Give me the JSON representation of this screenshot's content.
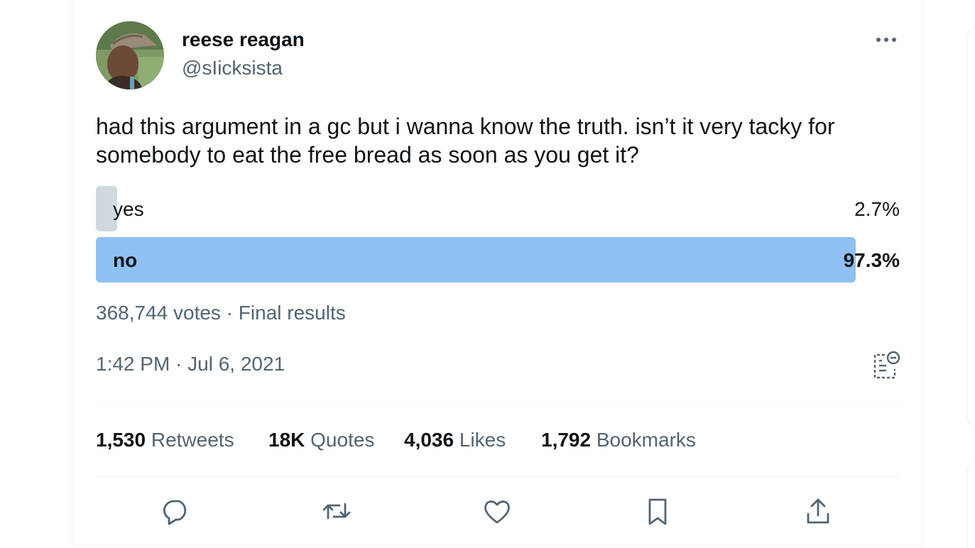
{
  "tweet": {
    "author": {
      "display_name": "reese reagan",
      "handle": "@sIicksista"
    },
    "text": "had this argument in a gc but i wanna know the truth. isn’t it very tacky for somebody to eat the free bread as soon as you get it?",
    "poll": {
      "options": [
        {
          "label": "yes",
          "percent_text": "2.7%",
          "percent": 2.7,
          "winner": false
        },
        {
          "label": "no",
          "percent_text": "97.3%",
          "percent": 97.3,
          "winner": true
        }
      ],
      "meta": "368,744 votes · Final results"
    },
    "timestamp": "1:42 PM · Jul 6, 2021",
    "stats": {
      "retweets": {
        "count": "1,530",
        "label": "Retweets"
      },
      "quotes": {
        "count": "18K",
        "label": "Quotes"
      },
      "likes": {
        "count": "4,036",
        "label": "Likes"
      },
      "bookmarks": {
        "count": "1,792",
        "label": "Bookmarks"
      }
    },
    "actions": [
      "reply-icon",
      "retweet-icon",
      "like-icon",
      "bookmark-icon",
      "share-icon"
    ],
    "colors": {
      "text_primary": "#0f1419",
      "text_secondary": "#536471",
      "poll_winner": "#8ec1f2",
      "poll_other": "#cfd9de",
      "divider": "#eff3f4"
    }
  }
}
